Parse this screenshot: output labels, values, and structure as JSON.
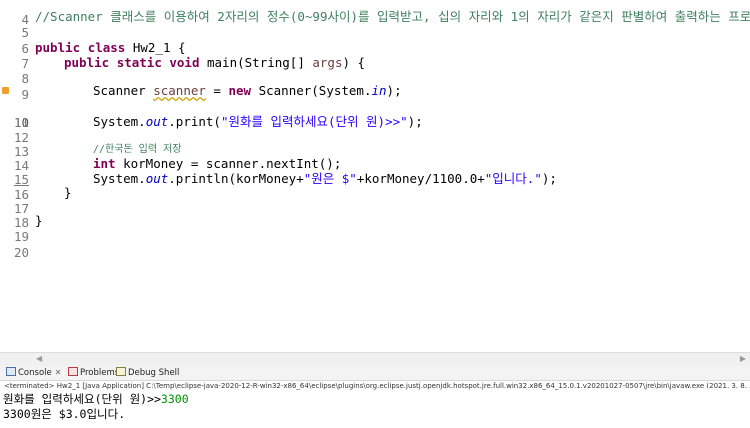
{
  "editor": {
    "lines": [
      {
        "num": "4",
        "text": ""
      },
      {
        "num": "5",
        "comment": "//Scanner 클래스를 이용하여 2자리의 정수(0~99사이)를 입력받고, 십의 자리와 1의 자리가 같은지 판별하여 출력하는 프로그램을 작성하라."
      },
      {
        "num": "6",
        "text": ""
      },
      {
        "num": "7",
        "kw1": "public",
        "kw2": "class",
        "text": " Hw2_1 {"
      },
      {
        "num": "8",
        "kw1": "public",
        "kw2": "static",
        "kw3": "void",
        "text": " main(String[] ",
        "arg": "args",
        "tail": ") {"
      },
      {
        "num": "9",
        "text": ""
      },
      {
        "num": "10",
        "pre": "Scanner ",
        "var": "scanner",
        "mid": " = ",
        "kw": "new",
        "post": " Scanner(System.",
        "fld": "in",
        "tail": ");"
      },
      {
        "num": "11",
        "text": ""
      },
      {
        "num": "12",
        "pre": "System.",
        "fld": "out",
        "mid": ".print(",
        "str": "\"원화를 입력하세요(단위 원)>>\"",
        "tail": ");"
      },
      {
        "num": "13",
        "text": ""
      },
      {
        "num": "14",
        "comment": "//한국돈 입력 저장"
      },
      {
        "num": "15",
        "kw": "int",
        "text": " korMoney = scanner.nextInt();"
      },
      {
        "num": "16",
        "pre": "System.",
        "fld": "out",
        "mid": ".println(korMoney+",
        "str1": "\"원은 $\"",
        "mid2": "+korMoney/1100.0+",
        "str2": "\"입니다.\"",
        "tail": ");"
      },
      {
        "num": "17",
        "text": "}"
      },
      {
        "num": "18",
        "text": ""
      },
      {
        "num": "19",
        "text": "}"
      },
      {
        "num": "20",
        "text": ""
      }
    ]
  },
  "tabs": {
    "console": "Console",
    "problems": "Problems",
    "debug": "Debug Shell"
  },
  "status": "<terminated> Hw2_1 [Java Application] C:\\Temp\\eclipse-java-2020-12-R-win32-x86_64\\eclipse\\plugins\\org.eclipse.justj.openjdk.hotspot.jre.full.win32.x86_64_15.0.1.v20201027-0507\\jre\\bin\\javaw.exe  (2021. 3. 8. 오후 5:",
  "console": {
    "prompt": "원화를 입력하세요(단위 원)>>",
    "input": "3300",
    "output": "3300원은 $3.0입니다."
  }
}
